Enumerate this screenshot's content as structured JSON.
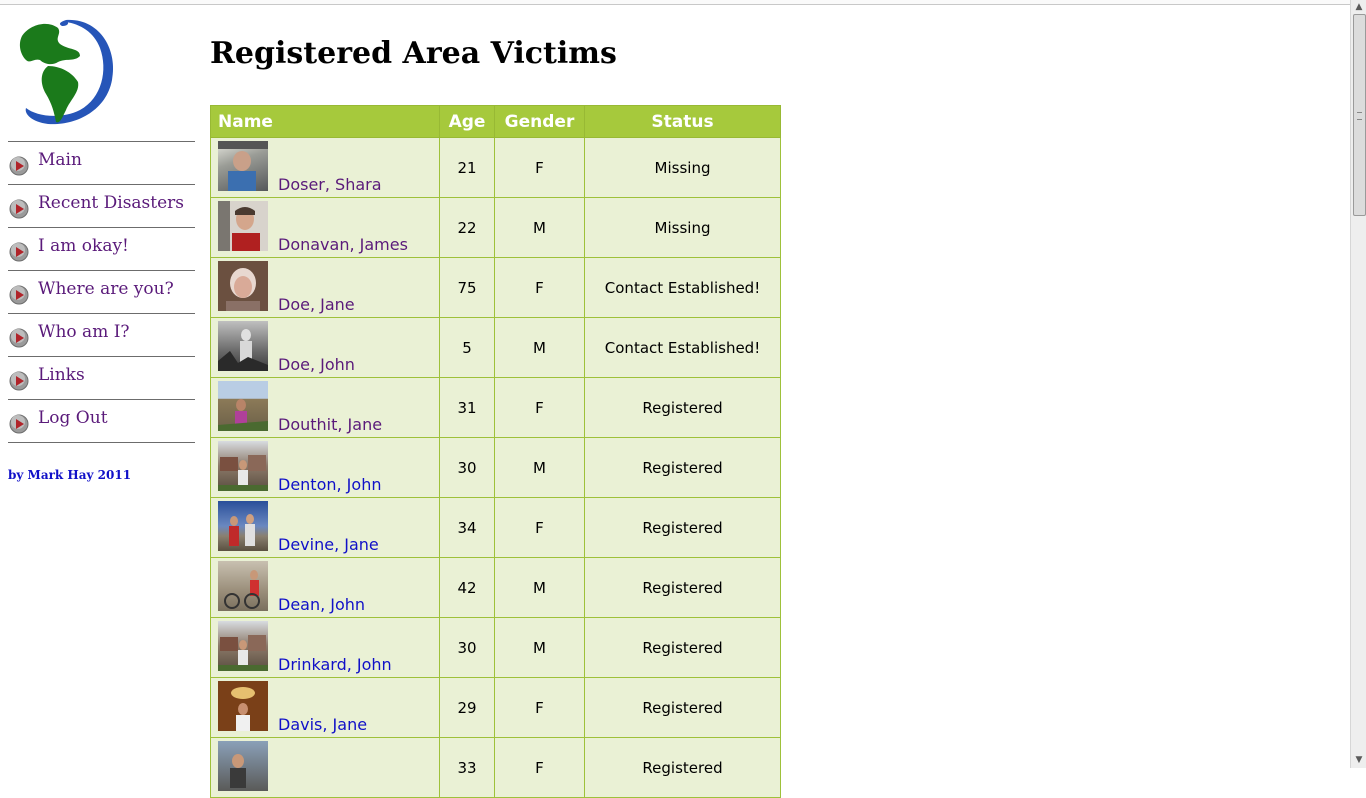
{
  "page": {
    "title": "Registered Area Victims",
    "credit": "by Mark Hay 2011"
  },
  "sidebar": {
    "logo_icon": "globe-americas-icon",
    "items": [
      {
        "label": "Main",
        "icon": "arrow-bullet-icon"
      },
      {
        "label": "Recent Disasters",
        "icon": "arrow-bullet-icon"
      },
      {
        "label": "I am okay!",
        "icon": "arrow-bullet-icon"
      },
      {
        "label": "Where are you?",
        "icon": "arrow-bullet-icon"
      },
      {
        "label": "Who am I?",
        "icon": "arrow-bullet-icon"
      },
      {
        "label": "Links",
        "icon": "arrow-bullet-icon"
      },
      {
        "label": "Log Out",
        "icon": "arrow-bullet-icon"
      }
    ]
  },
  "table": {
    "headers": {
      "name": "Name",
      "age": "Age",
      "gender": "Gender",
      "status": "Status"
    },
    "rows": [
      {
        "name": "Doser, Shara",
        "age": "21",
        "gender": "F",
        "status": "Missing",
        "visited": true
      },
      {
        "name": "Donavan, James",
        "age": "22",
        "gender": "M",
        "status": "Missing",
        "visited": true
      },
      {
        "name": "Doe, Jane",
        "age": "75",
        "gender": "F",
        "status": "Contact Established!",
        "visited": true
      },
      {
        "name": "Doe, John",
        "age": "5",
        "gender": "M",
        "status": "Contact Established!",
        "visited": true
      },
      {
        "name": "Douthit, Jane",
        "age": "31",
        "gender": "F",
        "status": "Registered",
        "visited": true
      },
      {
        "name": "Denton, John",
        "age": "30",
        "gender": "M",
        "status": "Registered",
        "visited": false
      },
      {
        "name": "Devine, Jane",
        "age": "34",
        "gender": "F",
        "status": "Registered",
        "visited": false
      },
      {
        "name": "Dean, John",
        "age": "42",
        "gender": "M",
        "status": "Registered",
        "visited": false
      },
      {
        "name": "Drinkard, John",
        "age": "30",
        "gender": "M",
        "status": "Registered",
        "visited": false
      },
      {
        "name": "Davis, Jane",
        "age": "29",
        "gender": "F",
        "status": "Registered",
        "visited": false
      },
      {
        "name": "",
        "age": "33",
        "gender": "F",
        "status": "Registered",
        "visited": false
      }
    ]
  },
  "colors": {
    "header_bg": "#a6c93c",
    "row_bg": "#eaf1d5",
    "visited_link": "#5a1a7a",
    "link": "#1010c8"
  }
}
